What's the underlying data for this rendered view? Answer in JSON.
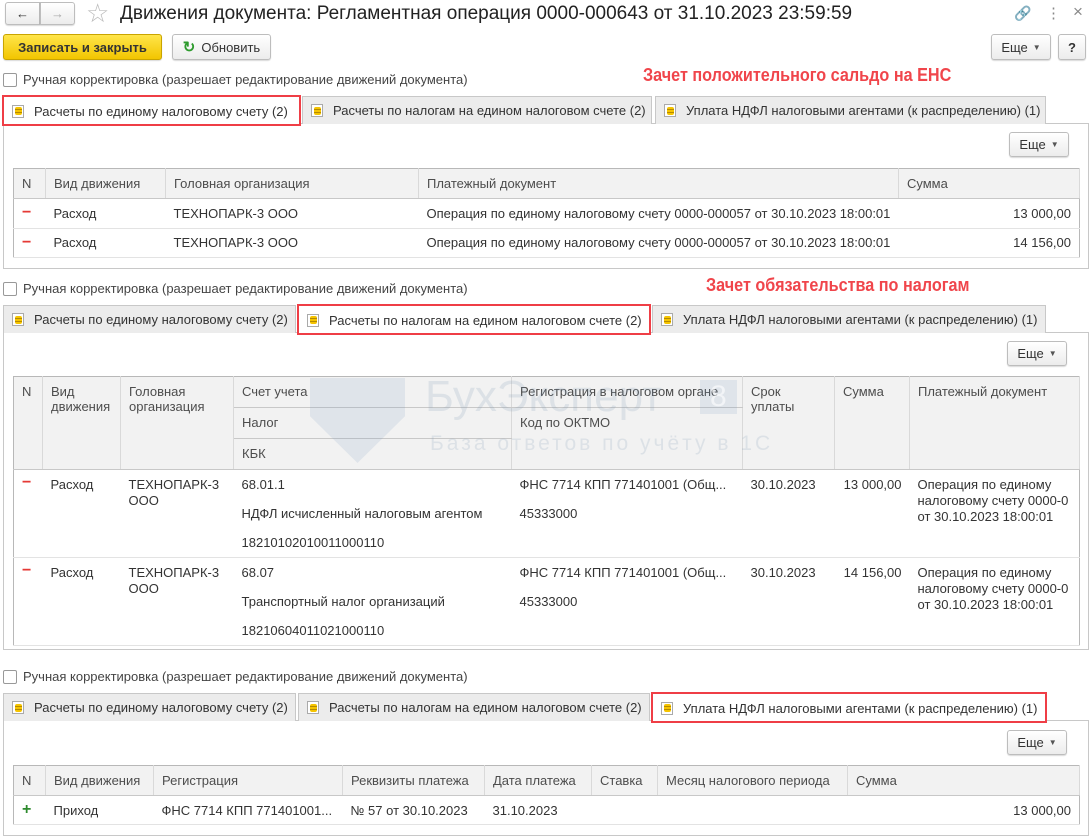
{
  "window": {
    "title": "Движения документа: Регламентная операция 0000-000643 от 31.10.2023 23:59:59",
    "back": "←",
    "forward": "→",
    "star": "☆",
    "link": "🔗",
    "menu": "⋮",
    "close": "×"
  },
  "toolbar": {
    "save_close": "Записать и закрыть",
    "refresh": "Обновить",
    "refresh_icon": "↻",
    "more": "Еще",
    "help": "?"
  },
  "checkbox_label": "Ручная корректировка (разрешает редактирование движений документа)",
  "annotations": {
    "first": "Зачет положительного сальдо на ЕНС",
    "second": "Зачет обязательства по налогам"
  },
  "tabs": [
    "Расчеты по единому налоговому счету (2)",
    "Расчеты по налогам на едином налоговом счете (2)",
    "Уплата НДФЛ налоговыми агентами (к распределению) (1)"
  ],
  "more_label": "Еще",
  "watermark": {
    "brand": "БухЭксперт",
    "badge": "8",
    "tagline": "База ответов по учёту в 1С"
  },
  "table1": {
    "headers": [
      "N",
      "Вид движения",
      "Головная организация",
      "Платежный документ",
      "Сумма"
    ],
    "rows": [
      {
        "sign": "−",
        "kind": "Расход",
        "org": "ТЕХНОПАРК-3 ООО",
        "doc": "Операция по единому налоговому счету 0000-000057 от 30.10.2023 18:00:01",
        "sum": "13 000,00"
      },
      {
        "sign": "−",
        "kind": "Расход",
        "org": "ТЕХНОПАРК-3 ООО",
        "doc": "Операция по единому налоговому счету 0000-000057 от 30.10.2023 18:00:01",
        "sum": "14 156,00"
      }
    ]
  },
  "table2": {
    "headers": {
      "n": "N",
      "kind": "Вид движения",
      "org": "Головная организация",
      "account": "Счет учета",
      "tax": "Налог",
      "kbk": "КБК",
      "reg": "Регистрация в налоговом органе",
      "oktmo": "Код по ОКТМО",
      "due": "Срок уплаты",
      "sum": "Сумма",
      "doc": "Платежный документ"
    },
    "rows": [
      {
        "sign": "−",
        "kind": "Расход",
        "org": "ТЕХНОПАРК-3 ООО",
        "account": "68.01.1",
        "tax": "НДФЛ исчисленный налоговым агентом",
        "kbk": "18210102010011000110",
        "reg": "ФНС 7714 КПП 771401001 (Общ...",
        "oktmo": "45333000",
        "due": "30.10.2023",
        "sum": "13 000,00",
        "doc": "Операция по единому налоговому счету 0000-0 от 30.10.2023 18:00:01"
      },
      {
        "sign": "−",
        "kind": "Расход",
        "org": "ТЕХНОПАРК-3 ООО",
        "account": "68.07",
        "tax": "Транспортный налог организаций",
        "kbk": "18210604011021000110",
        "reg": "ФНС 7714 КПП 771401001 (Общ...",
        "oktmo": "45333000",
        "due": "30.10.2023",
        "sum": "14 156,00",
        "doc": "Операция по единому налоговому счету 0000-0 от 30.10.2023 18:00:01"
      }
    ]
  },
  "table3": {
    "headers": [
      "N",
      "Вид движения",
      "Регистрация",
      "Реквизиты платежа",
      "Дата платежа",
      "Ставка",
      "Месяц налогового периода",
      "Сумма"
    ],
    "rows": [
      {
        "sign": "+",
        "kind": "Приход",
        "reg": "ФНС 7714 КПП 771401001...",
        "req": "№ 57 от 30.10.2023",
        "date": "31.10.2023",
        "rate": "",
        "month": "",
        "sum": "13 000,00"
      }
    ]
  }
}
